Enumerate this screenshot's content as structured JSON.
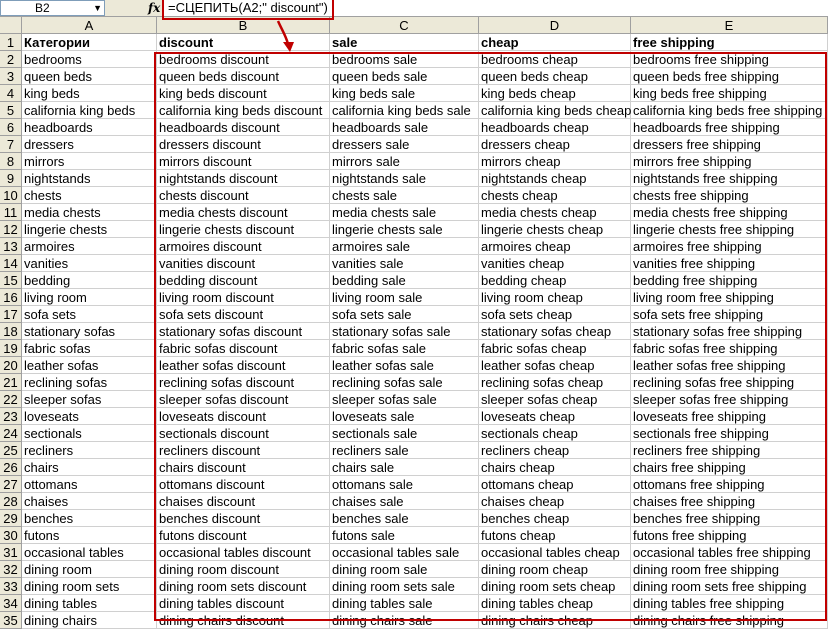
{
  "formula_bar": {
    "name_box": "B2",
    "fx_label": "fx",
    "formula": "=СЦЕПИТЬ(A2;\" discount\")"
  },
  "columns": [
    "A",
    "B",
    "C",
    "D",
    "E"
  ],
  "rows": [
    [
      "Категории",
      "discount",
      "sale",
      "cheap",
      "free shipping"
    ],
    [
      "bedrooms",
      "bedrooms discount",
      "bedrooms sale",
      "bedrooms cheap",
      "bedrooms free shipping"
    ],
    [
      "queen beds",
      "queen beds discount",
      "queen beds sale",
      "queen beds cheap",
      "queen beds free shipping"
    ],
    [
      "king beds",
      "king beds discount",
      "king beds sale",
      "king beds cheap",
      "king beds free shipping"
    ],
    [
      "california king beds",
      "california king beds discount",
      "california king beds sale",
      "california king beds cheap",
      "california king beds free shipping"
    ],
    [
      "headboards",
      "headboards discount",
      "headboards sale",
      "headboards cheap",
      "headboards free shipping"
    ],
    [
      "dressers",
      "dressers discount",
      "dressers sale",
      "dressers cheap",
      "dressers free shipping"
    ],
    [
      "mirrors",
      "mirrors discount",
      "mirrors sale",
      "mirrors cheap",
      "mirrors free shipping"
    ],
    [
      "nightstands",
      "nightstands discount",
      "nightstands sale",
      "nightstands cheap",
      "nightstands free shipping"
    ],
    [
      "chests",
      "chests discount",
      "chests sale",
      "chests cheap",
      "chests free shipping"
    ],
    [
      "media chests",
      "media chests discount",
      "media chests sale",
      "media chests cheap",
      "media chests free shipping"
    ],
    [
      "lingerie chests",
      "lingerie chests discount",
      "lingerie chests sale",
      "lingerie chests cheap",
      "lingerie chests free shipping"
    ],
    [
      "armoires",
      "armoires discount",
      "armoires sale",
      "armoires cheap",
      "armoires free shipping"
    ],
    [
      "vanities",
      "vanities discount",
      "vanities sale",
      "vanities cheap",
      "vanities free shipping"
    ],
    [
      "bedding",
      "bedding discount",
      "bedding sale",
      "bedding cheap",
      "bedding free shipping"
    ],
    [
      "living room",
      "living room discount",
      "living room sale",
      "living room cheap",
      "living room free shipping"
    ],
    [
      "sofa sets",
      "sofa sets discount",
      "sofa sets sale",
      "sofa sets cheap",
      "sofa sets free shipping"
    ],
    [
      "stationary sofas",
      "stationary sofas discount",
      "stationary sofas sale",
      "stationary sofas cheap",
      "stationary sofas free shipping"
    ],
    [
      "fabric sofas",
      "fabric sofas discount",
      "fabric sofas sale",
      "fabric sofas cheap",
      "fabric sofas free shipping"
    ],
    [
      "leather sofas",
      "leather sofas discount",
      "leather sofas sale",
      "leather sofas cheap",
      "leather sofas free shipping"
    ],
    [
      "reclining sofas",
      "reclining sofas discount",
      "reclining sofas sale",
      "reclining sofas cheap",
      "reclining sofas free shipping"
    ],
    [
      "sleeper sofas",
      "sleeper sofas discount",
      "sleeper sofas sale",
      "sleeper sofas cheap",
      "sleeper sofas free shipping"
    ],
    [
      "loveseats",
      "loveseats discount",
      "loveseats sale",
      "loveseats cheap",
      "loveseats free shipping"
    ],
    [
      "sectionals",
      "sectionals discount",
      "sectionals sale",
      "sectionals cheap",
      "sectionals free shipping"
    ],
    [
      "recliners",
      "recliners discount",
      "recliners sale",
      "recliners cheap",
      "recliners free shipping"
    ],
    [
      "chairs",
      "chairs discount",
      "chairs sale",
      "chairs cheap",
      "chairs free shipping"
    ],
    [
      "ottomans",
      "ottomans discount",
      "ottomans sale",
      "ottomans cheap",
      "ottomans free shipping"
    ],
    [
      "chaises",
      "chaises discount",
      "chaises sale",
      "chaises cheap",
      "chaises free shipping"
    ],
    [
      "benches",
      "benches discount",
      "benches sale",
      "benches cheap",
      "benches free shipping"
    ],
    [
      "futons",
      "futons discount",
      "futons sale",
      "futons cheap",
      "futons free shipping"
    ],
    [
      "occasional tables",
      "occasional tables discount",
      "occasional tables sale",
      "occasional tables cheap",
      "occasional tables free shipping"
    ],
    [
      "dining room",
      "dining room discount",
      "dining room sale",
      "dining room cheap",
      "dining room free shipping"
    ],
    [
      "dining room sets",
      "dining room sets discount",
      "dining room sets sale",
      "dining room sets cheap",
      "dining room sets free shipping"
    ],
    [
      "dining tables",
      "dining tables discount",
      "dining tables sale",
      "dining tables cheap",
      "dining tables free shipping"
    ],
    [
      "dining chairs",
      "dining chairs discount",
      "dining chairs sale",
      "dining chairs cheap",
      "dining chairs free shipping"
    ]
  ],
  "colors": {
    "highlight": "#c00000",
    "header_bg": "#ece9d8"
  },
  "icons": {
    "name_box_dropdown": "chevron-down-icon",
    "callout": "arrow-icon"
  }
}
